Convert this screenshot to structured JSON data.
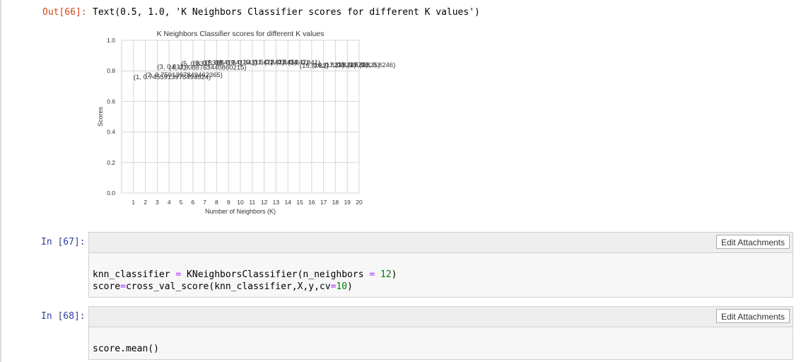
{
  "output_cell": {
    "prompt": "Out[66]:",
    "text": "Text(0.5, 1.0, 'K Neighbors Classifier scores for different K values')"
  },
  "chart_data": {
    "type": "scatter",
    "title": "K Neighbors Classifier scores for different K values",
    "xlabel": "Number of Neighbors (K)",
    "ylabel": "Scores",
    "xlim": [
      0,
      20
    ],
    "ylim": [
      0,
      1.0
    ],
    "xticks": [
      "1",
      "2",
      "3",
      "4",
      "5",
      "6",
      "7",
      "8",
      "9",
      "10",
      "11",
      "12",
      "13",
      "14",
      "15",
      "16",
      "17",
      "18",
      "19",
      "20"
    ],
    "yticks": [
      "0.0",
      "0.2",
      "0.4",
      "0.6",
      "0.8",
      "1.0"
    ],
    "grid": true,
    "markers": false,
    "annotations": "(k, score) text at each point",
    "x": [
      1,
      2,
      3,
      4,
      5,
      6,
      7,
      8,
      9,
      10,
      11,
      12,
      13,
      14,
      15,
      16,
      17,
      18,
      19,
      20
    ],
    "y": [
      0.7455913978494624,
      0.7591397849462365,
      0.812,
      0.8088763440860215,
      0.833,
      0.838,
      0.84,
      0.84,
      0.841,
      0.842,
      0.842,
      0.843,
      0.842,
      0.841,
      0.82,
      0.823,
      0.824,
      0.826,
      0.825,
      0.8246
    ]
  },
  "cells": [
    {
      "prompt": "In [67]:",
      "button": "Edit Attachments",
      "code": [
        [
          [
            "knn_classifier ",
            ""
          ],
          [
            "=",
            "op"
          ],
          [
            " KNeighborsClassifier(n_neighbors ",
            ""
          ],
          [
            "=",
            "op"
          ],
          [
            " ",
            ""
          ],
          [
            "12",
            "num"
          ],
          [
            ")",
            ""
          ]
        ],
        [
          [
            "score",
            ""
          ],
          [
            "=",
            "op"
          ],
          [
            "cross_val_score(knn_classifier,X,y,cv",
            ""
          ],
          [
            "=",
            "op"
          ],
          [
            "10",
            "num"
          ],
          [
            ")",
            ""
          ]
        ]
      ]
    },
    {
      "prompt": "In [68]:",
      "button": "Edit Attachments",
      "code": [
        [
          [
            "score.mean()",
            ""
          ]
        ]
      ]
    }
  ]
}
